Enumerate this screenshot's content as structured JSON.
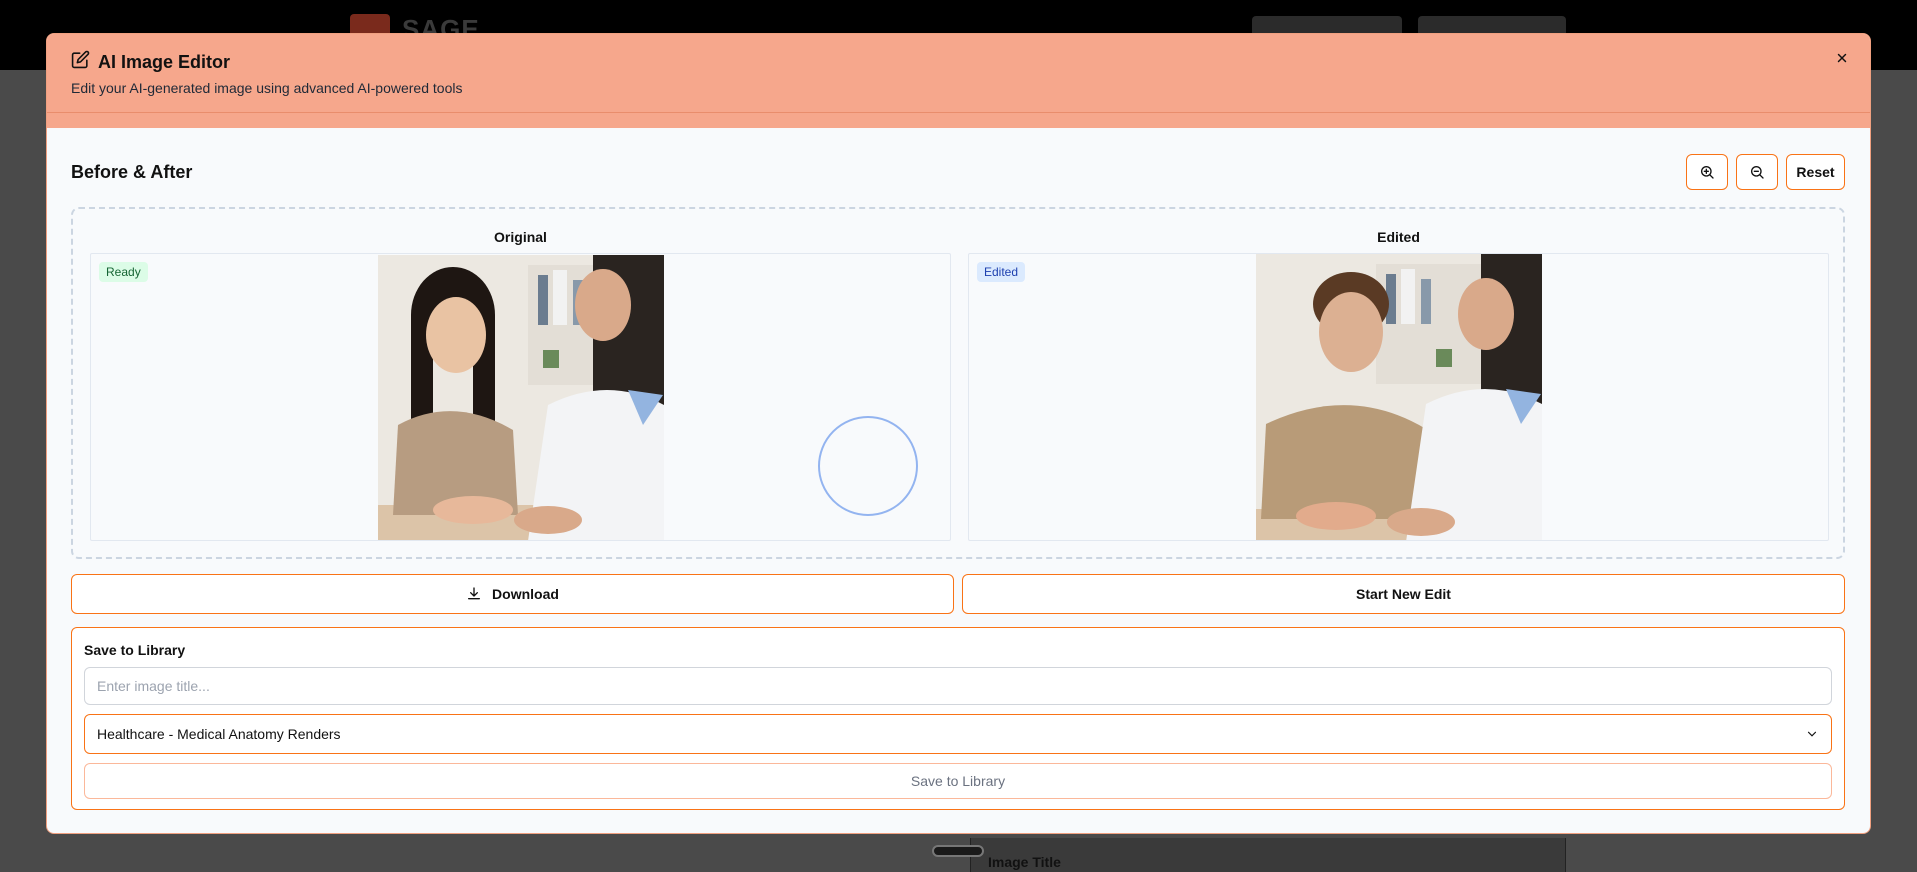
{
  "background": {
    "logo_text": "SAGE",
    "image_title_label": "Image Title"
  },
  "modal": {
    "title": "AI Image Editor",
    "subtitle": "Edit your AI-generated image using advanced AI-powered tools",
    "section_title": "Before & After",
    "tools": {
      "zoom_in_icon": "zoom-in-icon",
      "zoom_out_icon": "zoom-out-icon",
      "reset_label": "Reset"
    },
    "original": {
      "label": "Original",
      "badge": "Ready"
    },
    "edited": {
      "label": "Edited",
      "badge": "Edited"
    },
    "download_label": "Download",
    "start_new_label": "Start New Edit",
    "library": {
      "title": "Save to Library",
      "title_placeholder": "Enter image title...",
      "category_selected": "Healthcare - Medical Anatomy Renders",
      "save_label": "Save to Library"
    }
  },
  "colors": {
    "header": "#f6a78c",
    "accent": "#f97316",
    "ready_badge": "#dcfce7",
    "edited_badge": "#dbeafe"
  }
}
